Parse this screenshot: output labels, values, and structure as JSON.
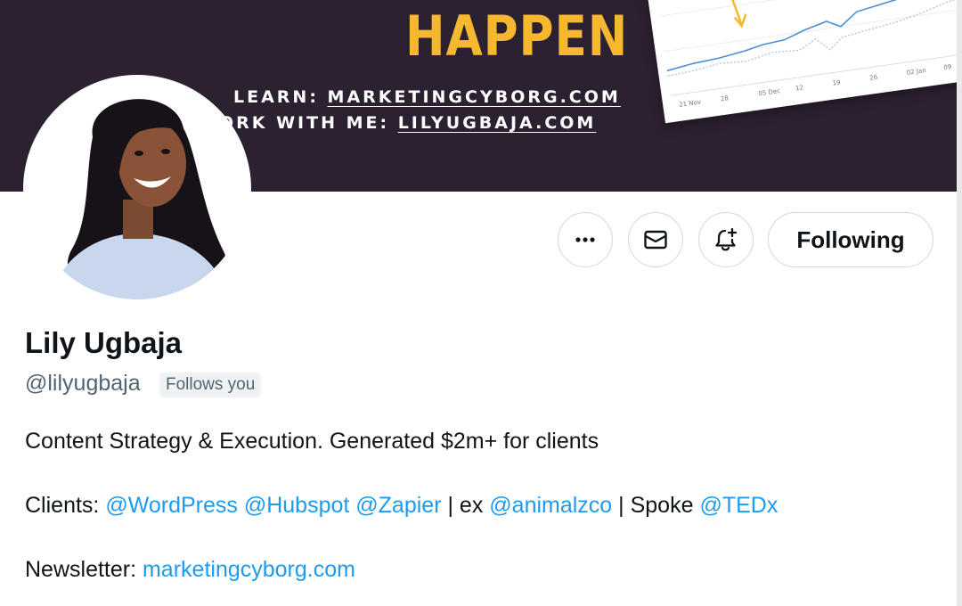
{
  "banner": {
    "headline": "HAPPEN",
    "line1_prefix": "LEARN: ",
    "line1_link": "MARKETINGCYBORG.COM",
    "line2_prefix": "WORK WITH ME: ",
    "line2_link": "LILYUGBAJA.COM",
    "chart_ticks": [
      "21 Nov",
      "28",
      "05 Dec",
      "12",
      "19",
      "26",
      "02 Jan",
      "09"
    ],
    "colors": {
      "background": "#2c2130",
      "headline": "#f5b82e",
      "arrow": "#f5b82e"
    }
  },
  "actions": {
    "more_icon": "more-horizontal-icon",
    "message_icon": "envelope-icon",
    "notify_icon": "bell-plus-icon",
    "follow_label": "Following"
  },
  "profile": {
    "name": "Lily Ugbaja",
    "handle": "@lilyugbaja",
    "follows_you": "Follows you"
  },
  "bio": {
    "line1": "Content Strategy & Execution. Generated $2m+ for clients",
    "line2": {
      "prefix": "Clients: ",
      "mention1": "@WordPress",
      "mention2": "@Hubspot",
      "mention3": "@Zapier",
      "sep1": " | ex ",
      "mention4": "@animalzco",
      "sep2": " | Spoke ",
      "mention5": "@TEDx"
    },
    "line3": {
      "prefix": "Newsletter: ",
      "link": "marketingcyborg.com"
    }
  },
  "colors": {
    "accent": "#1d9bf0",
    "text": "#0f1419",
    "secondary": "#536471",
    "border": "#cfd9de"
  }
}
